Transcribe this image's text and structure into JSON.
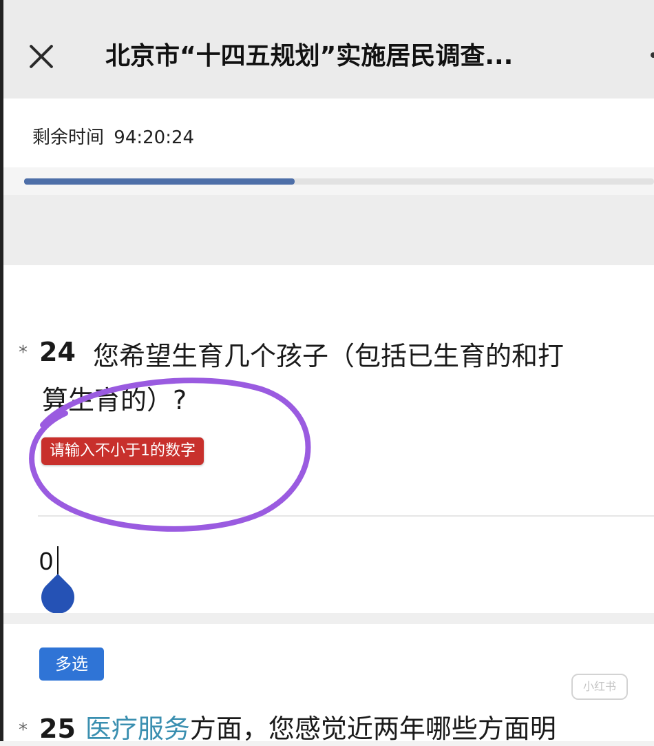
{
  "header": {
    "title": "北京市“十四五规划”实施居民调查...",
    "close_icon": "close-icon",
    "more_icon": "more-icon"
  },
  "timer": {
    "label": "剩余时间",
    "value": "94:20:24"
  },
  "progress": {
    "fraction": 0.43,
    "fill_color": "#4e6fa8"
  },
  "question24": {
    "required_mark": "*",
    "number": "24",
    "text_line1": "您希望生育几个孩子（包括已生育的和打",
    "text_line2": "算生育的）?",
    "error_message": "请输入不小于1的数字",
    "error_color": "#c8302c",
    "answer_value": "0"
  },
  "multi_select_badge": "多选",
  "question25": {
    "required_mark": "*",
    "number": "25",
    "highlight": "医疗服务",
    "text_rest": "方面，您感觉近两年哪些方面明"
  },
  "watermark": {
    "badge": "小红书"
  },
  "annotation": {
    "color": "#9a5be0"
  }
}
